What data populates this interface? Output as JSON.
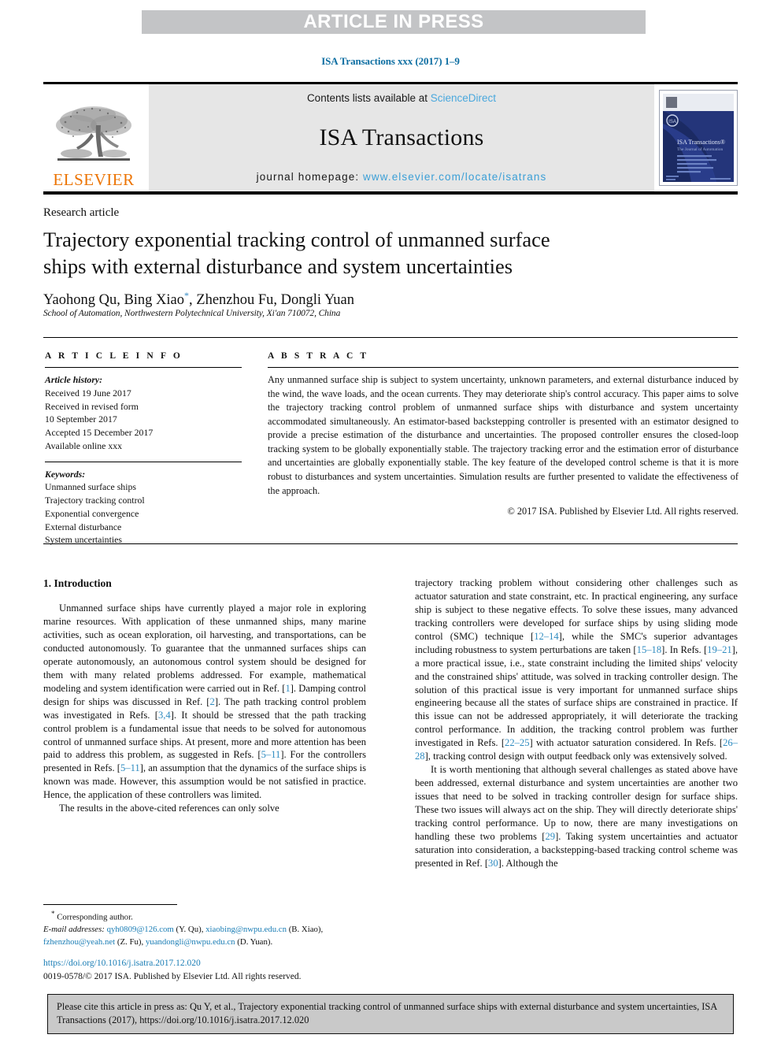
{
  "banner": {
    "text": "ARTICLE IN PRESS"
  },
  "running_head": "ISA Transactions xxx (2017) 1–9",
  "masthead": {
    "publisher_name": "ELSEVIER",
    "contents_prefix": "Contents lists available at ",
    "contents_link": "ScienceDirect",
    "journal_name": "ISA Transactions",
    "homepage_prefix": "journal homepage: ",
    "homepage_link": "www.elsevier.com/locate/isatrans",
    "cover_title": "ISA Transactions",
    "cover_subtitle": "The Journal of Automation"
  },
  "article": {
    "type_label": "Research article",
    "title": "Trajectory exponential tracking control of unmanned surface ships with external disturbance and system uncertainties",
    "authors": "Yaohong Qu, Bing Xiao",
    "authors_rest": ", Zhenzhou Fu, Dongli Yuan",
    "corresponding_marker": "*",
    "affiliation": "School of Automation, Northwestern Polytechnical University, Xi'an 710072, China"
  },
  "article_info": {
    "heading": "A R T I C L E   I N F O",
    "history_label": "Article history:",
    "history": [
      "Received 19 June 2017",
      "Received in revised form",
      "10 September 2017",
      "Accepted 15 December 2017",
      "Available online xxx"
    ],
    "keywords_label": "Keywords:",
    "keywords": [
      "Unmanned surface ships",
      "Trajectory tracking control",
      "Exponential convergence",
      "External disturbance",
      "System uncertainties"
    ]
  },
  "abstract": {
    "heading": "A B S T R A C T",
    "text": "Any unmanned surface ship is subject to system uncertainty, unknown parameters, and external disturbance induced by the wind, the wave loads, and the ocean currents. They may deteriorate ship's control accuracy. This paper aims to solve the trajectory tracking control problem of unmanned surface ships with disturbance and system uncertainty accommodated simultaneously. An estimator-based backstepping controller is presented with an estimator designed to provide a precise estimation of the disturbance and uncertainties. The proposed controller ensures the closed-loop tracking system to be globally exponentially stable. The trajectory tracking error and the estimation error of disturbance and uncertainties are globally exponentially stable. The key feature of the developed control scheme is that it is more robust to disturbances and system uncertainties. Simulation results are further presented to validate the effectiveness of the approach.",
    "copyright": "© 2017 ISA. Published by Elsevier Ltd. All rights reserved."
  },
  "body": {
    "section_heading": "1. Introduction",
    "left_paragraph_1_a": "Unmanned surface ships have currently played a major role in exploring marine resources. With application of these unmanned ships, many marine activities, such as ocean exploration, oil harvesting, and transportations, can be conducted autonomously. To guarantee that the unmanned surfaces ships can operate autonomously, an autonomous control system should be designed for them with many related problems addressed. For example, mathematical modeling and system identification were carried out in Ref. [",
    "ref_1": "1",
    "left_paragraph_1_b": "]. Damping control design for ships was discussed in Ref. [",
    "ref_2": "2",
    "left_paragraph_1_c": "]. The path tracking control problem was investigated in Refs. [",
    "ref_34": "3,4",
    "left_paragraph_1_d": "]. It should be stressed that the path tracking control problem is a fundamental issue that needs to be solved for autonomous control of unmanned surface ships. At present, more and more attention has been paid to address this problem, as suggested in Refs. [",
    "ref_511a": "5–11",
    "left_paragraph_1_e": "]. For the controllers presented in Refs. [",
    "ref_511b": "5–11",
    "left_paragraph_1_f": "], an assumption that the dynamics of the surface ships is known was made. However, this assumption would be not satisfied in practice. Hence, the application of these controllers was limited.",
    "left_paragraph_2": "The results in the above-cited references can only solve",
    "right_paragraph_1_a": "trajectory tracking problem without considering other challenges such as actuator saturation and state constraint, etc. In practical engineering, any surface ship is subject to these negative effects. To solve these issues, many advanced tracking controllers were developed for surface ships by using sliding mode control (SMC) technique [",
    "ref_1214": "12–14",
    "right_paragraph_1_b": "], while the SMC's superior advantages including robustness to system perturbations are taken [",
    "ref_1518": "15–18",
    "right_paragraph_1_c": "]. In Refs. [",
    "ref_1921": "19–21",
    "right_paragraph_1_d": "], a more practical issue, i.e., state constraint including the limited ships' velocity and the constrained ships' attitude, was solved in tracking controller design. The solution of this practical issue is very important for unmanned surface ships engineering because all the states of surface ships are constrained in practice. If this issue can not be addressed appropriately, it will deteriorate the tracking control performance. In addition, the tracking control problem was further investigated in Refs. [",
    "ref_2225": "22–25",
    "right_paragraph_1_e": "] with actuator saturation considered. In Refs. [",
    "ref_2628": "26–28",
    "right_paragraph_1_f": "], tracking control design with output feedback only was extensively solved.",
    "right_paragraph_2_a": "It is worth mentioning that although several challenges as stated above have been addressed, external disturbance and system uncertainties are another two issues that need to be solved in tracking controller design for surface ships. These two issues will always act on the ship. They will directly deteriorate ships' tracking control performance. Up to now, there are many investigations on handling these two problems [",
    "ref_29": "29",
    "right_paragraph_2_b": "]. Taking system uncertainties and actuator saturation into consideration, a backstepping-based tracking control scheme was presented in Ref. [",
    "ref_30": "30",
    "right_paragraph_2_c": "]. Although the"
  },
  "footnotes": {
    "corresponding_marker": "*",
    "corresponding_text": "Corresponding author.",
    "email_label": "E-mail addresses:",
    "email_1": "qyh0809@126.com",
    "email_1_owner": "(Y. Qu),",
    "email_2": "xiaobing@nwpu.edu.cn",
    "email_2_owner": "(B. Xiao),",
    "email_3": "fzhenzhou@yeah.net",
    "email_3_owner": "(Z. Fu),",
    "email_4": "yuandongli@nwpu.edu.cn",
    "email_4_owner": "(D. Yuan).",
    "doi_link": "https://doi.org/10.1016/j.isatra.2017.12.020",
    "issn_line": "0019-0578/© 2017 ISA. Published by Elsevier Ltd. All rights reserved."
  },
  "citation_box": {
    "text": "Please cite this article in press as: Qu Y, et al., Trajectory exponential tracking control of unmanned surface ships with external disturbance and system uncertainties, ISA Transactions (2017), https://doi.org/10.1016/j.isatra.2017.12.020"
  },
  "colors": {
    "banner_gray": "#c3c4c6",
    "running_head_blue": "#0d6ea2",
    "link_blue": "#3b9fd6",
    "ref_blue": "#2e8bc0",
    "elsevier_orange": "#ec7404",
    "masthead_gray": "#e6e6e6",
    "citation_box_gray": "#c9c9c9"
  }
}
